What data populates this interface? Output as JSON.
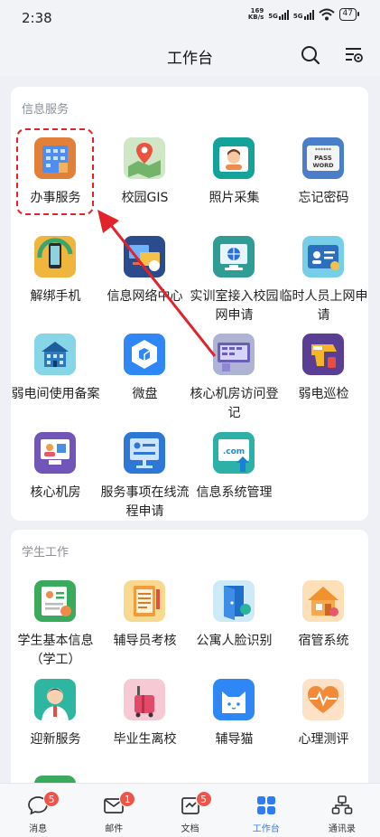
{
  "status_bar": {
    "time": "2:38",
    "net_speed_value": "169",
    "net_speed_unit": "KB/s",
    "sig1": "5G",
    "sig2": "5G",
    "battery": "47"
  },
  "header": {
    "title": "工作台"
  },
  "sections": [
    {
      "title": "信息服务",
      "items": [
        {
          "label": "办事服务",
          "icon": "office-building-icon"
        },
        {
          "label": "校园GIS",
          "icon": "map-pin-icon"
        },
        {
          "label": "照片采集",
          "icon": "camera-portrait-icon"
        },
        {
          "label": "忘记密码",
          "icon": "password-card-icon"
        },
        {
          "label": "解绑手机",
          "icon": "phone-unbind-icon"
        },
        {
          "label": "信息网络中心",
          "icon": "network-center-icon"
        },
        {
          "label": "实训室接入校园网申请",
          "icon": "globe-monitor-icon"
        },
        {
          "label": "临时人员上网申请",
          "icon": "id-card-icon"
        },
        {
          "label": "弱电间使用备案",
          "icon": "building-network-icon"
        },
        {
          "label": "微盘",
          "icon": "cloud-disk-icon"
        },
        {
          "label": "核心机房访问登记",
          "icon": "server-room-icon"
        },
        {
          "label": "弱电巡检",
          "icon": "inspection-gun-icon"
        },
        {
          "label": "核心机房",
          "icon": "core-room-icon"
        },
        {
          "label": "服务事项在线流程申请",
          "icon": "process-board-icon"
        },
        {
          "label": "信息系统管理",
          "icon": "dotcom-system-icon"
        }
      ]
    },
    {
      "title": "学生工作",
      "items": [
        {
          "label": "学生基本信息（学工）",
          "icon": "student-info-icon"
        },
        {
          "label": "辅导员考核",
          "icon": "notebook-icon"
        },
        {
          "label": "公寓人脸识别",
          "icon": "door-face-icon"
        },
        {
          "label": "宿管系统",
          "icon": "dorm-house-icon"
        },
        {
          "label": "迎新服务",
          "icon": "welcome-person-icon"
        },
        {
          "label": "毕业生离校",
          "icon": "luggage-icon"
        },
        {
          "label": "辅导猫",
          "icon": "cat-icon"
        },
        {
          "label": "心理测评",
          "icon": "heart-pulse-icon"
        }
      ]
    }
  ],
  "tabs": [
    {
      "label": "消息",
      "badge": "5",
      "icon": "message-icon"
    },
    {
      "label": "邮件",
      "badge": "1",
      "icon": "mail-icon"
    },
    {
      "label": "文档",
      "badge": "5",
      "icon": "document-icon"
    },
    {
      "label": "工作台",
      "badge": "",
      "icon": "workbench-icon",
      "active": true
    },
    {
      "label": "通讯录",
      "badge": "",
      "icon": "contacts-icon"
    }
  ],
  "colors": {
    "accent": "#2f7bf0",
    "badge": "#f05347",
    "annotation": "#e2232a"
  }
}
